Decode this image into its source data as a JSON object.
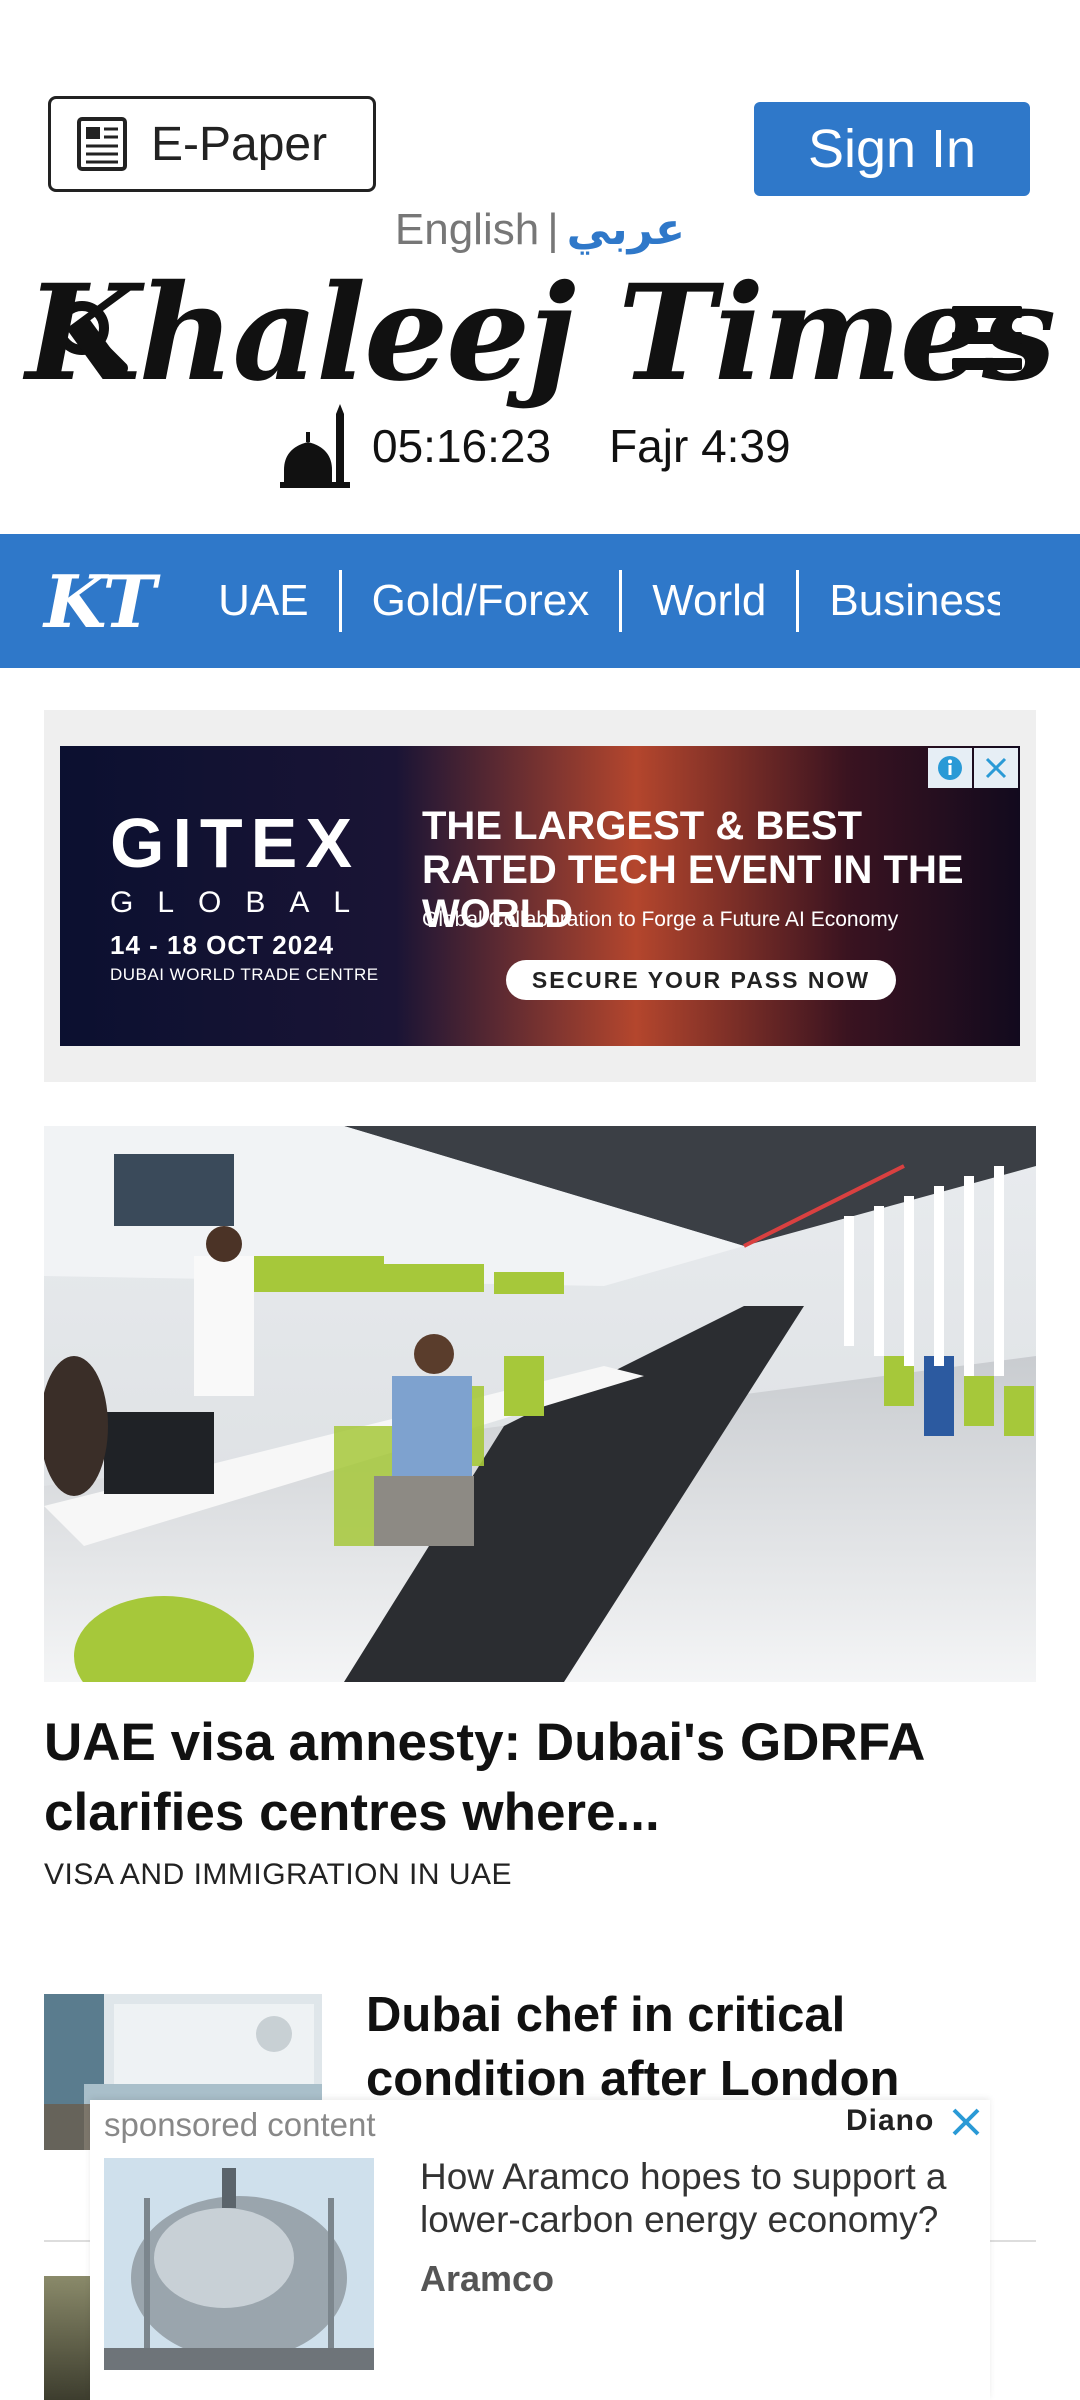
{
  "header": {
    "epaper_label": "E-Paper",
    "signin_label": "Sign In",
    "lang_english": "English",
    "lang_sep": "|",
    "lang_arabic": "عربي",
    "logo_text": "Khaleej Times",
    "clock": "05:16:23",
    "prayer": "Fajr 4:39"
  },
  "nav": {
    "logo": "KT",
    "items": [
      "UAE",
      "Gold/Forex",
      "World",
      "Business"
    ]
  },
  "ad": {
    "brand": "GITEX",
    "brand_sub": "GLOBAL",
    "dates": "14 - 18 OCT 2024",
    "venue": "DUBAI WORLD TRADE CENTRE",
    "headline": "THE LARGEST & BEST RATED TECH EVENT IN THE WORLD",
    "sub": "Global Collaboration to Forge a Future AI Economy",
    "cta": "SECURE YOUR PASS NOW"
  },
  "lead": {
    "title": "UAE visa amnesty: Dubai's GDRFA clarifies centres where...",
    "category": "VISA AND IMMIGRATION IN UAE"
  },
  "story2": {
    "title": "Dubai chef in critical condition after London"
  },
  "sponsored": {
    "label": "sponsored content",
    "provider": "Diano",
    "title": "How Aramco hopes to support a lower-carbon energy economy?",
    "source": "Aramco"
  },
  "colors": {
    "brand_blue": "#2f78c9",
    "accent_green": "#a6c83a"
  }
}
